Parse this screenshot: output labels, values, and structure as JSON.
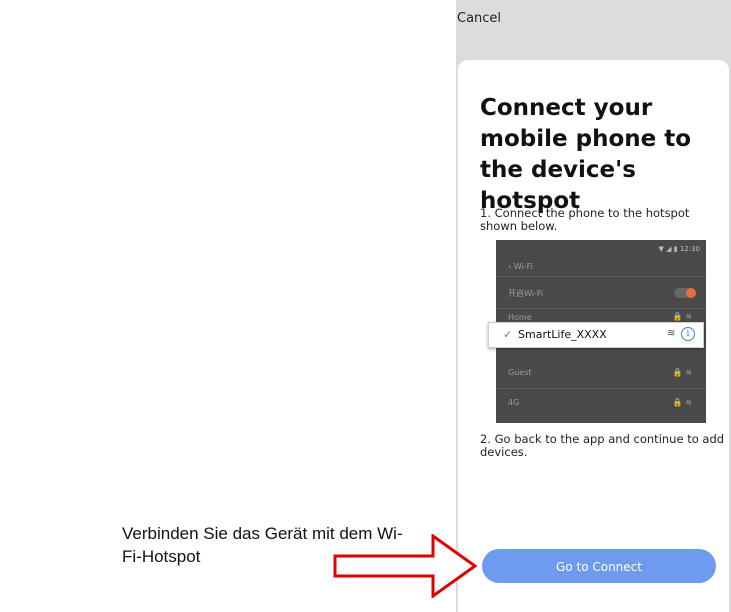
{
  "phone": {
    "cancel_label": "Cancel",
    "title": "Connect your mobile phone to the device's hotspot",
    "step1": "1. Connect the phone to the hotspot shown below.",
    "step2": "2. Go back to the app and continue to add devices.",
    "connect_button": "Go to Connect",
    "mock_wifi": {
      "clock": "12:30",
      "back_label": "Wi-Fi",
      "toggle_row": "开启Wi-Fi",
      "networks": [
        "Home",
        "Guest",
        "4G"
      ],
      "selected_ssid": "SmartLife_XXXX"
    }
  },
  "annotation": {
    "caption": "Verbinden Sie das Gerät mit dem Wi-Fi-Hotspot",
    "arrow_color": "#e00000"
  },
  "colors": {
    "accent": "#6e9af0",
    "topbar": "#dcdcdc"
  }
}
